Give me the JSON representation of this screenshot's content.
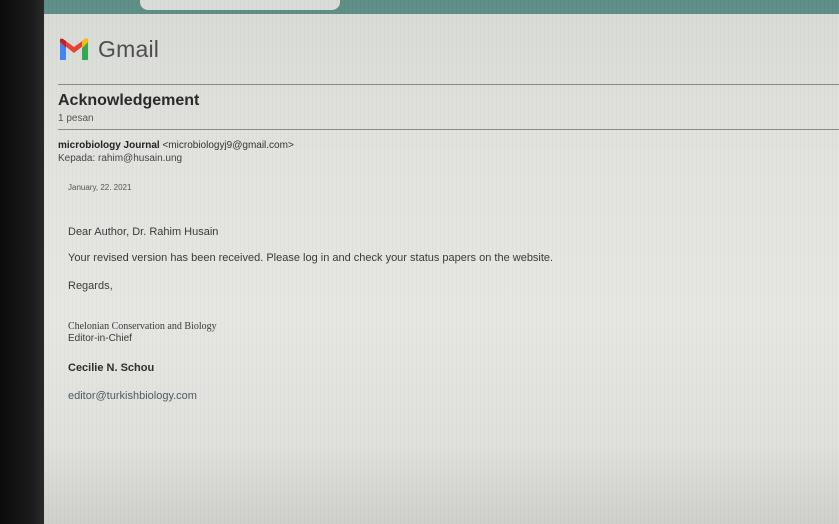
{
  "app": {
    "name": "Gmail",
    "brand_colors": {
      "red": "#ea4335",
      "blue": "#4285f4",
      "green": "#34a853",
      "yellow": "#fbbc05"
    }
  },
  "thread": {
    "subject": "Acknowledgement",
    "message_count": "1 pesan"
  },
  "message": {
    "sender_name": "microbiology Journal",
    "sender_email": "<microbiologyj9@gmail.com>",
    "recipient": "Kepada: rahim@husain.ung",
    "date": "January, 22. 2021",
    "greeting": "Dear Author,  Dr. Rahim Husain",
    "body": "Your revised version has been received. Please log in and check  your status papers on the website.",
    "closing": "Regards,",
    "journal_name": "Chelonian Conservation and Biology",
    "role": "Editor-in-Chief",
    "signer": "Cecilie N. Schou",
    "signer_email": "editor@turkishbiology.com"
  },
  "icons": {
    "logo": "gmail-m-logo"
  }
}
